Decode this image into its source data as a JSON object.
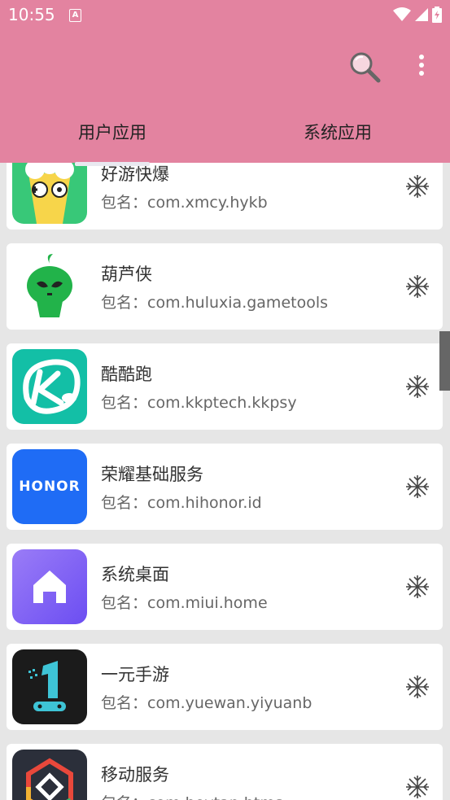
{
  "status_bar": {
    "time": "10:55",
    "notification_icon": "A"
  },
  "toolbar": {
    "search_icon": "search-icon",
    "more_icon": "more-vert-icon"
  },
  "tabs": [
    {
      "label": "用户应用",
      "selected": true
    },
    {
      "label": "系统应用",
      "selected": false
    }
  ],
  "colors": {
    "appbar": "#e383a0",
    "background": "#e6e6e6",
    "card": "#ffffff"
  },
  "apps": [
    {
      "name": "好游快爆",
      "package": "包名：com.xmcy.hykb",
      "icon": "haoyou-popcorn-icon"
    },
    {
      "name": "葫芦侠",
      "package": "包名：com.huluxia.gametools",
      "icon": "huluxia-alien-icon"
    },
    {
      "name": "酷酷跑",
      "package": "包名：com.kkptech.kkpsy",
      "icon": "kukupao-icon"
    },
    {
      "name": "荣耀基础服务",
      "package": "包名：com.hihonor.id",
      "icon": "honor-icon"
    },
    {
      "name": "系统桌面",
      "package": "包名：com.miui.home",
      "icon": "home-icon"
    },
    {
      "name": "一元手游",
      "package": "包名：com.yuewan.yiyuanb",
      "icon": "yiyuan-icon"
    },
    {
      "name": "移动服务",
      "package": "包名：com.heytap.htms",
      "icon": "heytap-icon"
    }
  ],
  "honor_logo_text": "HONOR",
  "freeze_icon": "snowflake-icon"
}
